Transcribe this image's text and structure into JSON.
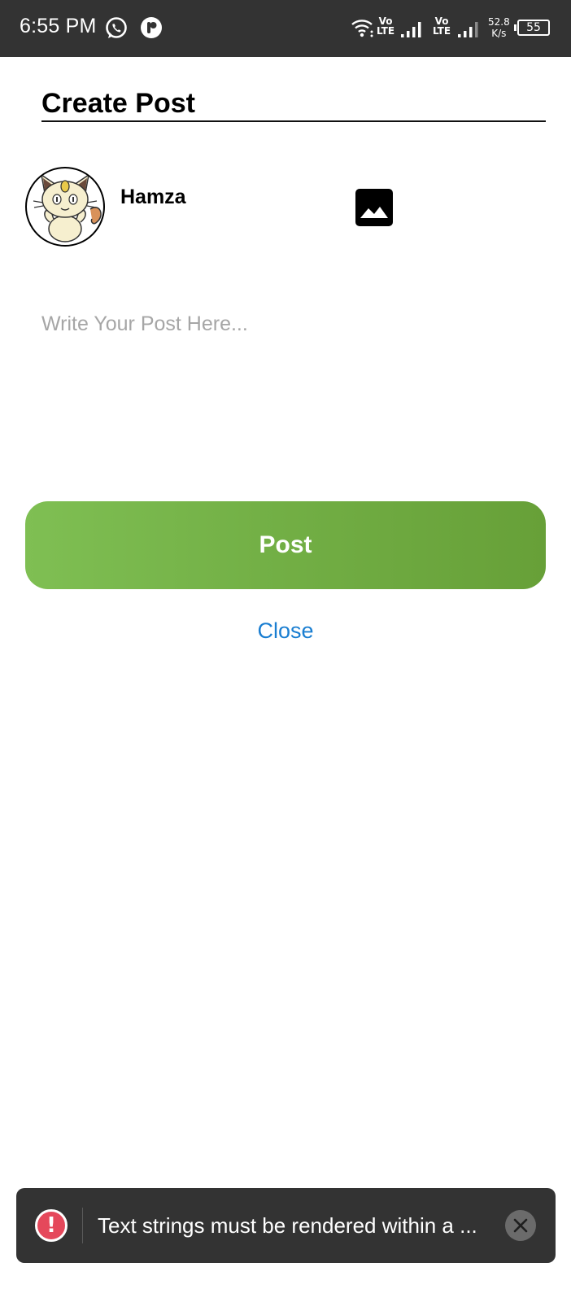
{
  "status_bar": {
    "time": "6:55 PM",
    "lte1_top": "Vo",
    "lte1_bottom": "LTE",
    "lte2_top": "Vo",
    "lte2_bottom": "LTE",
    "speed_value": "52.8",
    "speed_unit": "K/s",
    "battery": "55",
    "icons": [
      "whatsapp-icon",
      "app-notification-icon",
      "wifi-icon",
      "signal-icon",
      "signal-icon",
      "battery-icon"
    ]
  },
  "header": {
    "title": "Create Post"
  },
  "user": {
    "name": "Hamza",
    "avatar": "avatar"
  },
  "post": {
    "placeholder": "Write Your Post Here...",
    "value": "",
    "add_image_icon": "image-icon"
  },
  "actions": {
    "post_label": "Post",
    "close_label": "Close"
  },
  "toast": {
    "message": "Text strings must be rendered within a ...",
    "icon": "error-icon",
    "close_icon": "close-icon"
  },
  "colors": {
    "status_bar": "#333333",
    "post_button_start": "#7fbf53",
    "post_button_end": "#67a038",
    "close_link": "#1a7ed1",
    "toast_background": "#333333",
    "error_icon": "#e5485b"
  }
}
